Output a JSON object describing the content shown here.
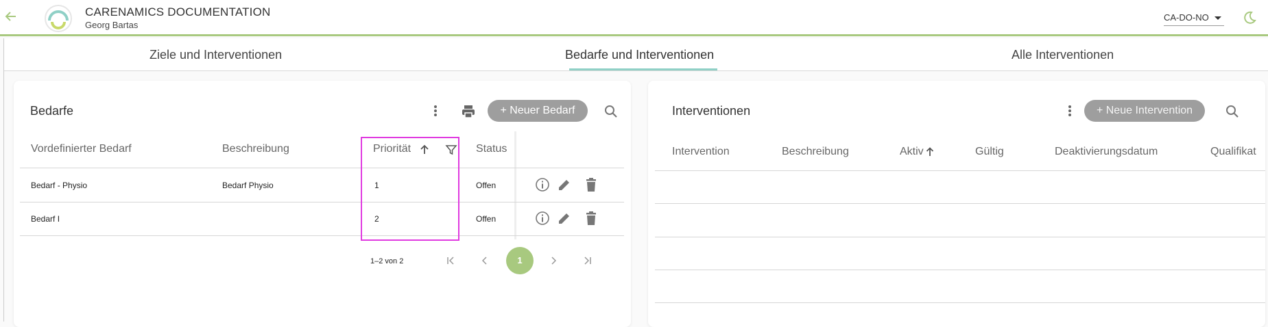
{
  "header": {
    "title": "CARENAMICS DOCUMENTATION",
    "subtitle": "Georg  Bartas",
    "org_selector": "CA-DO-NO"
  },
  "tabs": [
    {
      "label": "Ziele und Interventionen"
    },
    {
      "label": "Bedarfe und Interventionen",
      "active": true
    },
    {
      "label": "Alle Interventionen"
    }
  ],
  "bedarfe": {
    "title": "Bedarfe",
    "new_button": "+ Neuer Bedarf",
    "columns": [
      "Vordefinierter Bedarf",
      "Beschreibung",
      "Priorität",
      "Status"
    ],
    "rows": [
      {
        "bedarf": "Bedarf - Physio",
        "beschreibung": "Bedarf Physio",
        "prioritaet": "1",
        "status": "Offen"
      },
      {
        "bedarf": "Bedarf I",
        "beschreibung": "",
        "prioritaet": "2",
        "status": "Offen"
      }
    ],
    "paginator": {
      "range": "1–2 von 2",
      "current_page": "1"
    }
  },
  "interventionen": {
    "title": "Interventionen",
    "new_button": "+ Neue Intervention",
    "columns": [
      "Intervention",
      "Beschreibung",
      "Aktiv",
      "Gültig",
      "Deaktivierungsdatum",
      "Qualifikat"
    ]
  },
  "colors": {
    "accent": "#a8c97f",
    "tab_underline": "#8fd0c6",
    "highlight": "#e03ae0",
    "button": "#9e9e9e"
  }
}
